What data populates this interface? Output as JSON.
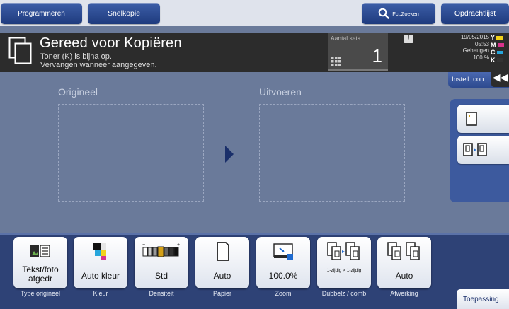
{
  "topbar": {
    "programmeren": "Programmeren",
    "snelkopie": "Snelkopie",
    "fct_zoeken": "Fct.Zoeken",
    "opdrachtlijst": "Opdrachtlijst"
  },
  "status": {
    "title": "Gereed voor Kopiëren",
    "msg1": "Toner (K) is bijna op.",
    "msg2": "Vervangen wanneer aangegeven.",
    "sets_label": "Aantal sets",
    "sets_value": "1",
    "warn": "!",
    "date": "19/05/2015",
    "time": "05:53",
    "memory_label": "Geheugen",
    "memory_value": "100 %",
    "toner": [
      {
        "letter": "Y",
        "color": "#f2d21b"
      },
      {
        "letter": "M",
        "color": "#d8338c"
      },
      {
        "letter": "C",
        "color": "#27a6dc"
      },
      {
        "letter": "K",
        "color": "#333333"
      }
    ]
  },
  "settings_tab": "Instell. con",
  "collapse": "◀◀",
  "main": {
    "origineel": "Origineel",
    "uitvoeren": "Uitvoeren"
  },
  "functions": [
    {
      "value": "Tekst/foto afgedr",
      "label": "Type origineel",
      "icon": "text-photo-icon"
    },
    {
      "value": "Auto kleur",
      "label": "Kleur",
      "icon": "color-icon"
    },
    {
      "value": "Std",
      "label": "Densiteit",
      "icon": "density-icon"
    },
    {
      "value": "Auto",
      "label": "Papier",
      "icon": "paper-icon"
    },
    {
      "value": "100.0%",
      "label": "Zoom",
      "icon": "zoom-icon"
    },
    {
      "value": "1-zijdig > 1-zijdig",
      "label": "Dubbelz / comb",
      "icon": "duplex-icon"
    },
    {
      "value": "Auto",
      "label": "Afwerking",
      "icon": "finishing-icon"
    }
  ],
  "toepassing": "Toepassing",
  "colors": {
    "accent": "#2e4276",
    "background": "#6a7a9a",
    "button_blue": "#1f3b7e"
  }
}
